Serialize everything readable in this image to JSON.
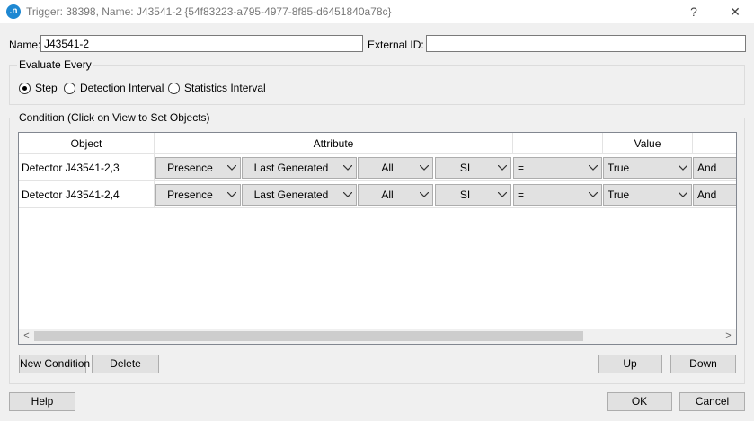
{
  "window": {
    "title": "Trigger: 38398, Name: J43541-2  {54f83223-a795-4977-8f85-d6451840a78c}",
    "app_icon": ".n",
    "help_glyph": "?",
    "close_glyph": "✕"
  },
  "form": {
    "name_label": "Name:",
    "name_value": "J43541-2",
    "external_id_label": "External ID:",
    "external_id_value": ""
  },
  "evaluate": {
    "title": "Evaluate Every",
    "options": [
      {
        "label": "Step",
        "checked": true
      },
      {
        "label": "Detection Interval",
        "checked": false
      },
      {
        "label": "Statistics Interval",
        "checked": false
      }
    ]
  },
  "condition": {
    "title": "Condition (Click on View to Set Objects)",
    "columns": {
      "object": "Object",
      "attribute": "Attribute",
      "operator": "",
      "value": "Value",
      "logic": ""
    },
    "rows": [
      {
        "object": "Detector J43541-2,3",
        "attr1": "Presence",
        "attr2": "Last Generated",
        "attr3": "All",
        "attr4": "SI",
        "operator": "=",
        "value": "True",
        "logic": "And"
      },
      {
        "object": "Detector J43541-2,4",
        "attr1": "Presence",
        "attr2": "Last Generated",
        "attr3": "All",
        "attr4": "SI",
        "operator": "=",
        "value": "True",
        "logic": "And"
      }
    ],
    "scroll_left": "<",
    "scroll_right": ">"
  },
  "buttons": {
    "new_condition": "New Condition",
    "delete": "Delete",
    "up": "Up",
    "down": "Down",
    "help": "Help",
    "ok": "OK",
    "cancel": "Cancel"
  }
}
